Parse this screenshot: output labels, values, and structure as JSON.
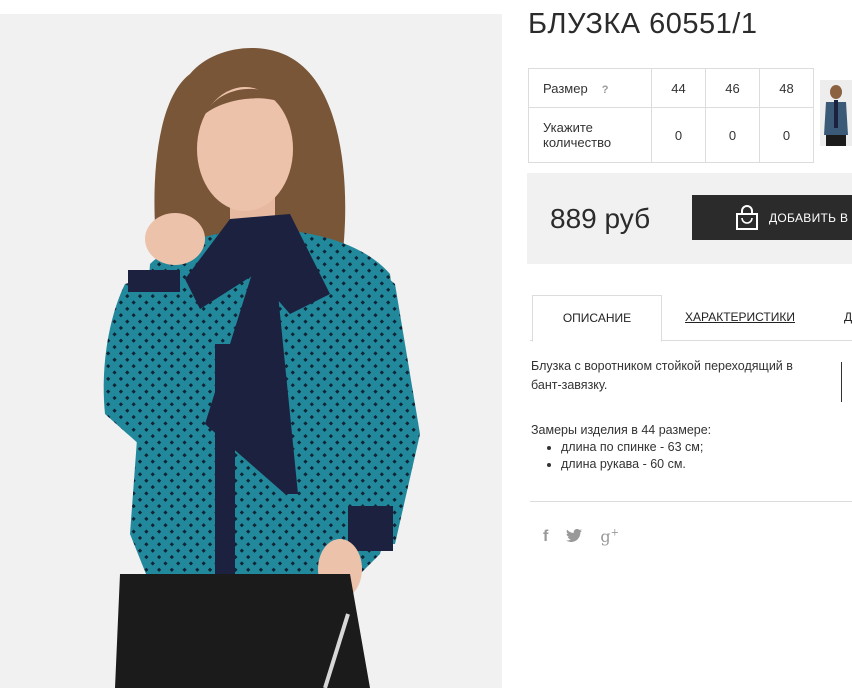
{
  "product": {
    "title": "БЛУЗКА 60551/1"
  },
  "sizes": {
    "label": "Размер",
    "help_mark": "?",
    "values": [
      "44",
      "46",
      "48"
    ],
    "qty_label_line1": "Укажите",
    "qty_label_line2": "количество",
    "quantities": [
      "0",
      "0",
      "0"
    ]
  },
  "price": {
    "amount": "889 руб",
    "add_to_cart": "ДОБАВИТЬ В"
  },
  "tabs": [
    "ОПИСАНИЕ",
    "ХАРАКТЕРИСТИКИ",
    "Д"
  ],
  "description": {
    "text": "Блузка с воротником стойкой переходящий в бант-завязку.",
    "measure_title": "Замеры изделия в 44 размере:",
    "measures": [
      "длина по спинке - 63 см;",
      "длина рукава - 60 см."
    ]
  },
  "social": [
    "f",
    "twitter",
    "g+"
  ],
  "colors": {
    "dark_button": "#2b2b2b",
    "panel_bg": "#f1f1f1",
    "blouse_teal": "#1f8a9c",
    "bow_navy": "#1c2140"
  }
}
